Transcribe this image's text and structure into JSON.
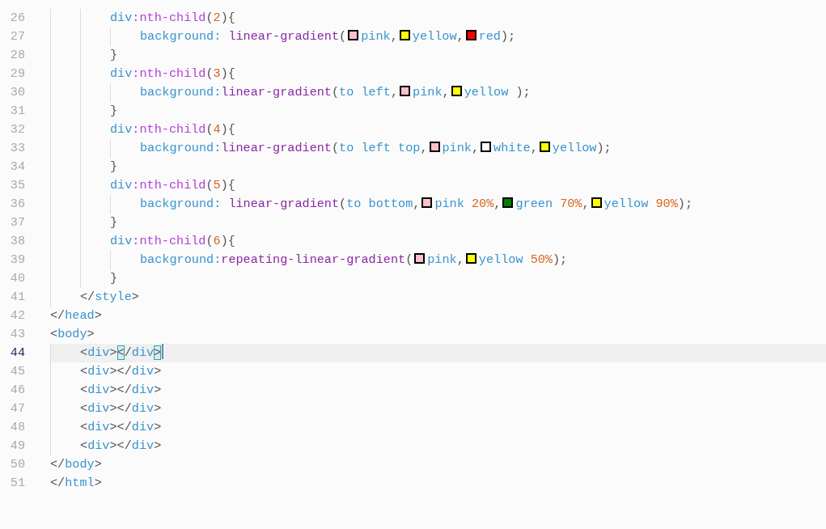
{
  "editor": {
    "lines": [
      {
        "children": [
          {
            "children": [
              {
                "number": "26",
                "current": false,
                "tokens": [
                  {
                    "kind": "tag",
                    "text": "div"
                  },
                  {
                    "kind": "pseudo",
                    "text": ":nth-child"
                  },
                  {
                    "kind": "punct",
                    "text": "("
                  },
                  {
                    "kind": "num",
                    "text": "2"
                  },
                  {
                    "kind": "punct",
                    "text": "){"
                  }
                ],
                "children": [
                  {
                    "number": "27",
                    "current": false,
                    "tokens": [
                      {
                        "kind": "prop",
                        "text": "background: "
                      },
                      {
                        "kind": "fn",
                        "text": "linear-gradient"
                      },
                      {
                        "kind": "punct",
                        "text": "("
                      },
                      {
                        "kind": "swatch",
                        "color": "#ffc0cb"
                      },
                      {
                        "kind": "value",
                        "text": "pink"
                      },
                      {
                        "kind": "punct",
                        "text": ","
                      },
                      {
                        "kind": "swatch",
                        "color": "#ffff00"
                      },
                      {
                        "kind": "value",
                        "text": "yellow"
                      },
                      {
                        "kind": "punct",
                        "text": ","
                      },
                      {
                        "kind": "swatch",
                        "color": "#ff0000"
                      },
                      {
                        "kind": "value",
                        "text": "red"
                      },
                      {
                        "kind": "punct",
                        "text": ");"
                      }
                    ]
                  }
                ]
              },
              {
                "number": "28",
                "current": false,
                "tokens": [
                  {
                    "kind": "punct",
                    "text": "}"
                  }
                ]
              },
              {
                "number": "29",
                "current": false,
                "tokens": [
                  {
                    "kind": "tag",
                    "text": "div"
                  },
                  {
                    "kind": "pseudo",
                    "text": ":nth-child"
                  },
                  {
                    "kind": "punct",
                    "text": "("
                  },
                  {
                    "kind": "num",
                    "text": "3"
                  },
                  {
                    "kind": "punct",
                    "text": "){"
                  }
                ],
                "children": [
                  {
                    "number": "30",
                    "current": false,
                    "tokens": [
                      {
                        "kind": "prop",
                        "text": "background:"
                      },
                      {
                        "kind": "fn",
                        "text": "linear-gradient"
                      },
                      {
                        "kind": "punct",
                        "text": "("
                      },
                      {
                        "kind": "value",
                        "text": "to left"
                      },
                      {
                        "kind": "punct",
                        "text": ","
                      },
                      {
                        "kind": "swatch",
                        "color": "#ffc0cb"
                      },
                      {
                        "kind": "value",
                        "text": "pink"
                      },
                      {
                        "kind": "punct",
                        "text": ","
                      },
                      {
                        "kind": "swatch",
                        "color": "#ffff00"
                      },
                      {
                        "kind": "value",
                        "text": "yellow"
                      },
                      {
                        "kind": "punct",
                        "text": " );"
                      }
                    ]
                  }
                ]
              },
              {
                "number": "31",
                "current": false,
                "tokens": [
                  {
                    "kind": "punct",
                    "text": "}"
                  }
                ]
              },
              {
                "number": "32",
                "current": false,
                "tokens": [
                  {
                    "kind": "tag",
                    "text": "div"
                  },
                  {
                    "kind": "pseudo",
                    "text": ":nth-child"
                  },
                  {
                    "kind": "punct",
                    "text": "("
                  },
                  {
                    "kind": "num",
                    "text": "4"
                  },
                  {
                    "kind": "punct",
                    "text": "){"
                  }
                ],
                "children": [
                  {
                    "number": "33",
                    "current": false,
                    "tokens": [
                      {
                        "kind": "prop",
                        "text": "background:"
                      },
                      {
                        "kind": "fn",
                        "text": "linear-gradient"
                      },
                      {
                        "kind": "punct",
                        "text": "("
                      },
                      {
                        "kind": "value",
                        "text": "to left top"
                      },
                      {
                        "kind": "punct",
                        "text": ","
                      },
                      {
                        "kind": "swatch",
                        "color": "#ffc0cb"
                      },
                      {
                        "kind": "value",
                        "text": "pink"
                      },
                      {
                        "kind": "punct",
                        "text": ","
                      },
                      {
                        "kind": "swatch",
                        "color": "#ffffff"
                      },
                      {
                        "kind": "value",
                        "text": "white"
                      },
                      {
                        "kind": "punct",
                        "text": ","
                      },
                      {
                        "kind": "swatch",
                        "color": "#ffff00"
                      },
                      {
                        "kind": "value",
                        "text": "yellow"
                      },
                      {
                        "kind": "punct",
                        "text": ");"
                      }
                    ]
                  }
                ]
              },
              {
                "number": "34",
                "current": false,
                "tokens": [
                  {
                    "kind": "punct",
                    "text": "}"
                  }
                ]
              },
              {
                "number": "35",
                "current": false,
                "tokens": [
                  {
                    "kind": "tag",
                    "text": "div"
                  },
                  {
                    "kind": "pseudo",
                    "text": ":nth-child"
                  },
                  {
                    "kind": "punct",
                    "text": "("
                  },
                  {
                    "kind": "num",
                    "text": "5"
                  },
                  {
                    "kind": "punct",
                    "text": "){"
                  }
                ],
                "children": [
                  {
                    "number": "36",
                    "current": false,
                    "tokens": [
                      {
                        "kind": "prop",
                        "text": "background: "
                      },
                      {
                        "kind": "fn",
                        "text": "linear-gradient"
                      },
                      {
                        "kind": "punct",
                        "text": "("
                      },
                      {
                        "kind": "value",
                        "text": "to bottom"
                      },
                      {
                        "kind": "punct",
                        "text": ","
                      },
                      {
                        "kind": "swatch",
                        "color": "#ffc0cb"
                      },
                      {
                        "kind": "value",
                        "text": "pink"
                      },
                      {
                        "kind": "num",
                        "text": " 20%"
                      },
                      {
                        "kind": "punct",
                        "text": ","
                      },
                      {
                        "kind": "swatch",
                        "color": "#008000"
                      },
                      {
                        "kind": "value",
                        "text": "green"
                      },
                      {
                        "kind": "num",
                        "text": " 70%"
                      },
                      {
                        "kind": "punct",
                        "text": ","
                      },
                      {
                        "kind": "swatch",
                        "color": "#ffff00"
                      },
                      {
                        "kind": "value",
                        "text": "yellow"
                      },
                      {
                        "kind": "num",
                        "text": " 90%"
                      },
                      {
                        "kind": "punct",
                        "text": ");"
                      }
                    ]
                  }
                ]
              },
              {
                "number": "37",
                "current": false,
                "tokens": [
                  {
                    "kind": "punct",
                    "text": "}"
                  }
                ]
              },
              {
                "number": "38",
                "current": false,
                "tokens": [
                  {
                    "kind": "tag",
                    "text": "div"
                  },
                  {
                    "kind": "pseudo",
                    "text": ":nth-child"
                  },
                  {
                    "kind": "punct",
                    "text": "("
                  },
                  {
                    "kind": "num",
                    "text": "6"
                  },
                  {
                    "kind": "punct",
                    "text": "){"
                  }
                ],
                "children": [
                  {
                    "number": "39",
                    "current": false,
                    "tokens": [
                      {
                        "kind": "prop",
                        "text": "background:"
                      },
                      {
                        "kind": "fn",
                        "text": "repeating-linear-gradient"
                      },
                      {
                        "kind": "punct",
                        "text": "("
                      },
                      {
                        "kind": "swatch",
                        "color": "#ffc0cb"
                      },
                      {
                        "kind": "value",
                        "text": "pink"
                      },
                      {
                        "kind": "punct",
                        "text": ","
                      },
                      {
                        "kind": "swatch",
                        "color": "#ffff00"
                      },
                      {
                        "kind": "value",
                        "text": "yellow"
                      },
                      {
                        "kind": "num",
                        "text": " 50%"
                      },
                      {
                        "kind": "punct",
                        "text": ");"
                      }
                    ]
                  }
                ]
              },
              {
                "number": "40",
                "current": false,
                "tokens": [
                  {
                    "kind": "punct",
                    "text": "}"
                  }
                ]
              }
            ]
          },
          {
            "number": "41",
            "current": false,
            "tokens": [
              {
                "kind": "punct",
                "text": "</"
              },
              {
                "kind": "tag",
                "text": "style"
              },
              {
                "kind": "punct",
                "text": ">"
              }
            ]
          }
        ]
      },
      {
        "number": "42",
        "current": false,
        "tokens": [
          {
            "kind": "punct",
            "text": "</"
          },
          {
            "kind": "tag",
            "text": "head"
          },
          {
            "kind": "punct",
            "text": ">"
          }
        ]
      },
      {
        "number": "43",
        "current": false,
        "tokens": [
          {
            "kind": "punct",
            "text": "<"
          },
          {
            "kind": "tag",
            "text": "body"
          },
          {
            "kind": "punct",
            "text": ">"
          }
        ],
        "children": [
          {
            "number": "44",
            "current": true,
            "tokens": [
              {
                "kind": "punct",
                "text": "<"
              },
              {
                "kind": "tag",
                "text": "div"
              },
              {
                "kind": "punct",
                "text": ">"
              },
              {
                "kind": "match",
                "text": "<"
              },
              {
                "kind": "punct",
                "text": "/"
              },
              {
                "kind": "tag",
                "text": "div"
              },
              {
                "kind": "match",
                "text": ">"
              }
            ]
          },
          {
            "number": "45",
            "current": false,
            "tokens": [
              {
                "kind": "punct",
                "text": "<"
              },
              {
                "kind": "tag",
                "text": "div"
              },
              {
                "kind": "punct",
                "text": "></"
              },
              {
                "kind": "tag",
                "text": "div"
              },
              {
                "kind": "punct",
                "text": ">"
              }
            ]
          },
          {
            "number": "46",
            "current": false,
            "tokens": [
              {
                "kind": "punct",
                "text": "<"
              },
              {
                "kind": "tag",
                "text": "div"
              },
              {
                "kind": "punct",
                "text": "></"
              },
              {
                "kind": "tag",
                "text": "div"
              },
              {
                "kind": "punct",
                "text": ">"
              }
            ]
          },
          {
            "number": "47",
            "current": false,
            "tokens": [
              {
                "kind": "punct",
                "text": "<"
              },
              {
                "kind": "tag",
                "text": "div"
              },
              {
                "kind": "punct",
                "text": "></"
              },
              {
                "kind": "tag",
                "text": "div"
              },
              {
                "kind": "punct",
                "text": ">"
              }
            ]
          },
          {
            "number": "48",
            "current": false,
            "tokens": [
              {
                "kind": "punct",
                "text": "<"
              },
              {
                "kind": "tag",
                "text": "div"
              },
              {
                "kind": "punct",
                "text": "></"
              },
              {
                "kind": "tag",
                "text": "div"
              },
              {
                "kind": "punct",
                "text": ">"
              }
            ]
          },
          {
            "number": "49",
            "current": false,
            "tokens": [
              {
                "kind": "punct",
                "text": "<"
              },
              {
                "kind": "tag",
                "text": "div"
              },
              {
                "kind": "punct",
                "text": "></"
              },
              {
                "kind": "tag",
                "text": "div"
              },
              {
                "kind": "punct",
                "text": ">"
              }
            ]
          }
        ]
      },
      {
        "number": "50",
        "current": false,
        "tokens": [
          {
            "kind": "punct",
            "text": "</"
          },
          {
            "kind": "tag",
            "text": "body"
          },
          {
            "kind": "punct",
            "text": ">"
          }
        ]
      },
      {
        "number": "51",
        "current": false,
        "tokens": [
          {
            "kind": "punct",
            "text": "</"
          },
          {
            "kind": "tag",
            "text": "html"
          },
          {
            "kind": "punct",
            "text": ">"
          }
        ]
      }
    ]
  }
}
